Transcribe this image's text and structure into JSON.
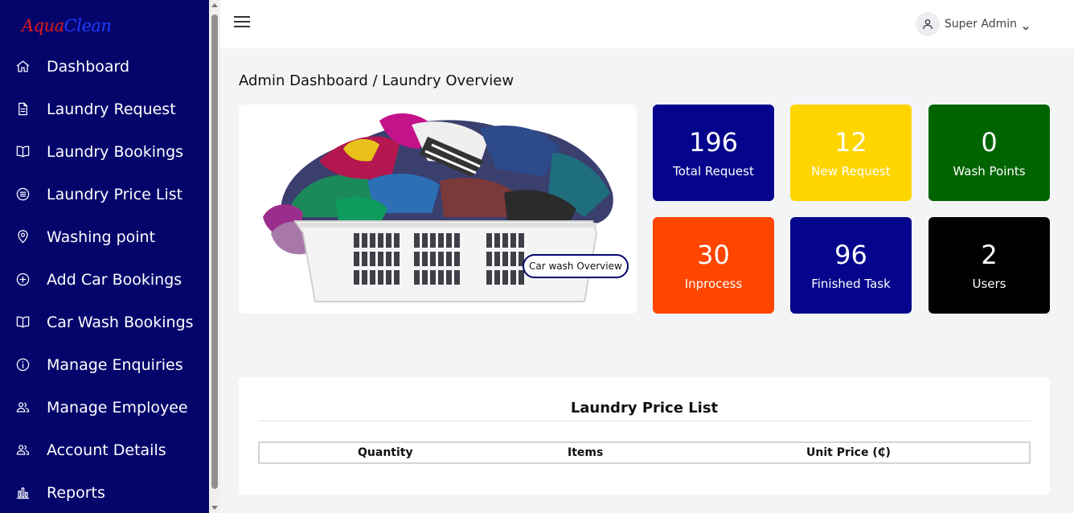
{
  "brand": {
    "part1": "Aqua",
    "part2": "Clean"
  },
  "sidebar": {
    "items": [
      {
        "label": "Dashboard",
        "icon": "home-icon"
      },
      {
        "label": "Laundry Request",
        "icon": "document-icon"
      },
      {
        "label": "Laundry Bookings",
        "icon": "book-icon"
      },
      {
        "label": "Laundry Price List",
        "icon": "list-circle-icon"
      },
      {
        "label": "Washing point",
        "icon": "map-pin-icon"
      },
      {
        "label": "Add Car Bookings",
        "icon": "plus-circle-icon"
      },
      {
        "label": "Car Wash Bookings",
        "icon": "book-icon"
      },
      {
        "label": "Manage Enquiries",
        "icon": "info-icon"
      },
      {
        "label": "Manage Employee",
        "icon": "users-icon"
      },
      {
        "label": "Account Details",
        "icon": "users-icon"
      },
      {
        "label": "Reports",
        "icon": "bar-chart-icon"
      }
    ]
  },
  "header": {
    "user_name": "Super Admin"
  },
  "breadcrumb": "Admin Dashboard / Laundry Overview",
  "hero": {
    "overview_button": "Car wash Overview"
  },
  "stats": [
    {
      "value": "196",
      "label": "Total Request",
      "bg": "#04048c",
      "fg": "#ffffff"
    },
    {
      "value": "12",
      "label": "New Request",
      "bg": "#ffd500",
      "fg": "#ffffff"
    },
    {
      "value": "0",
      "label": "Wash Points",
      "bg": "#006400",
      "fg": "#ffffff"
    },
    {
      "value": "30",
      "label": "Inprocess",
      "bg": "#ff4500",
      "fg": "#ffffff"
    },
    {
      "value": "96",
      "label": "Finished Task",
      "bg": "#04048c",
      "fg": "#ffffff"
    },
    {
      "value": "2",
      "label": "Users",
      "bg": "#000000",
      "fg": "#ffffff"
    }
  ],
  "price_list": {
    "title": "Laundry Price List",
    "columns": [
      "Quantity",
      "Items",
      "Unit Price (₵)"
    ]
  },
  "colors": {
    "sidebar": "#04056b",
    "page_bg": "#f3f4f6"
  }
}
